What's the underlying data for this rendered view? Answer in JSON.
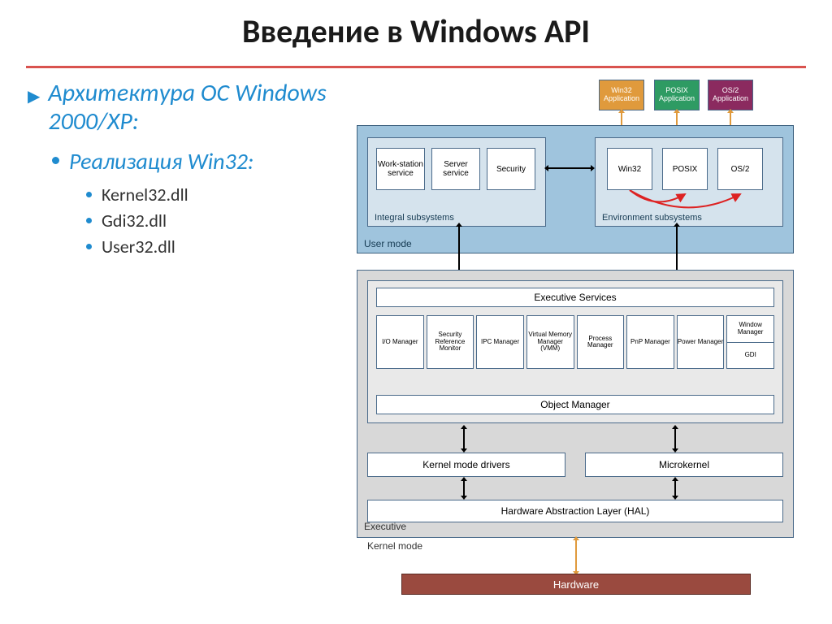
{
  "title": "Введение в Windows API",
  "bullets": {
    "l1": "Архитектура ОС Windows 2000/XP:",
    "l2": "Реализация Win32:",
    "l3": [
      "Kernel32.dll",
      "Gdi32.dll",
      "User32.dll"
    ]
  },
  "apps": {
    "win32": "Win32 Application",
    "posix": "POSIX Application",
    "os2": "OS/2 Application"
  },
  "usermode": {
    "label": "User mode",
    "integral": {
      "label": "Integral subsystems",
      "items": [
        "Work-station service",
        "Server service",
        "Security"
      ]
    },
    "env": {
      "label": "Environment subsystems",
      "items": [
        "Win32",
        "POSIX",
        "OS/2"
      ]
    }
  },
  "executive": {
    "label": "Executive",
    "services": "Executive Services",
    "managers": [
      "I/O Manager",
      "Security Reference Monitor",
      "IPC Manager",
      "Virtual Memory Manager (VMM)",
      "Process Manager",
      "PnP Manager",
      "Power Manager"
    ],
    "split": {
      "top": "Window Manager",
      "bottom": "GDI"
    },
    "object": "Object Manager"
  },
  "kernel": {
    "drivers": "Kernel mode drivers",
    "micro": "Microkernel",
    "hal": "Hardware Abstraction Layer (HAL)",
    "label": "Kernel mode"
  },
  "hardware": "Hardware"
}
